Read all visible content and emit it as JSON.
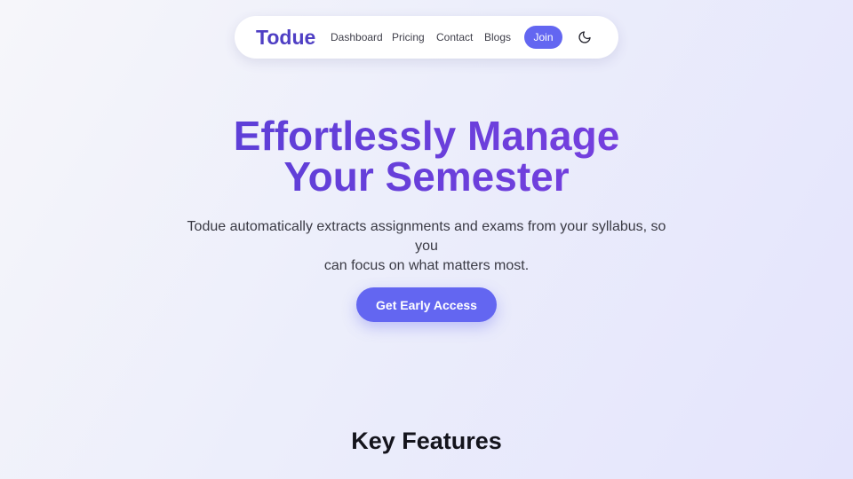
{
  "nav": {
    "brand": "Todue",
    "links": [
      {
        "label": "Dashboard"
      },
      {
        "label": "Pricing"
      },
      {
        "label": "Contact"
      },
      {
        "label": "Blogs"
      }
    ],
    "join_label": "Join",
    "theme_icon": "moon-icon"
  },
  "hero": {
    "title_line1": "Effortlessly Manage",
    "title_line2": "Your Semester",
    "subtitle_line1": "Todue automatically extracts assignments and exams from your syllabus, so you",
    "subtitle_line2": "can focus on what matters most.",
    "cta_label": "Get Early Access"
  },
  "features": {
    "title": "Key Features"
  },
  "colors": {
    "accent": "#6366f1",
    "brand": "#4f3fc4",
    "heading_gradient_start": "#5a3fd6",
    "heading_gradient_end": "#7a3fe0"
  }
}
